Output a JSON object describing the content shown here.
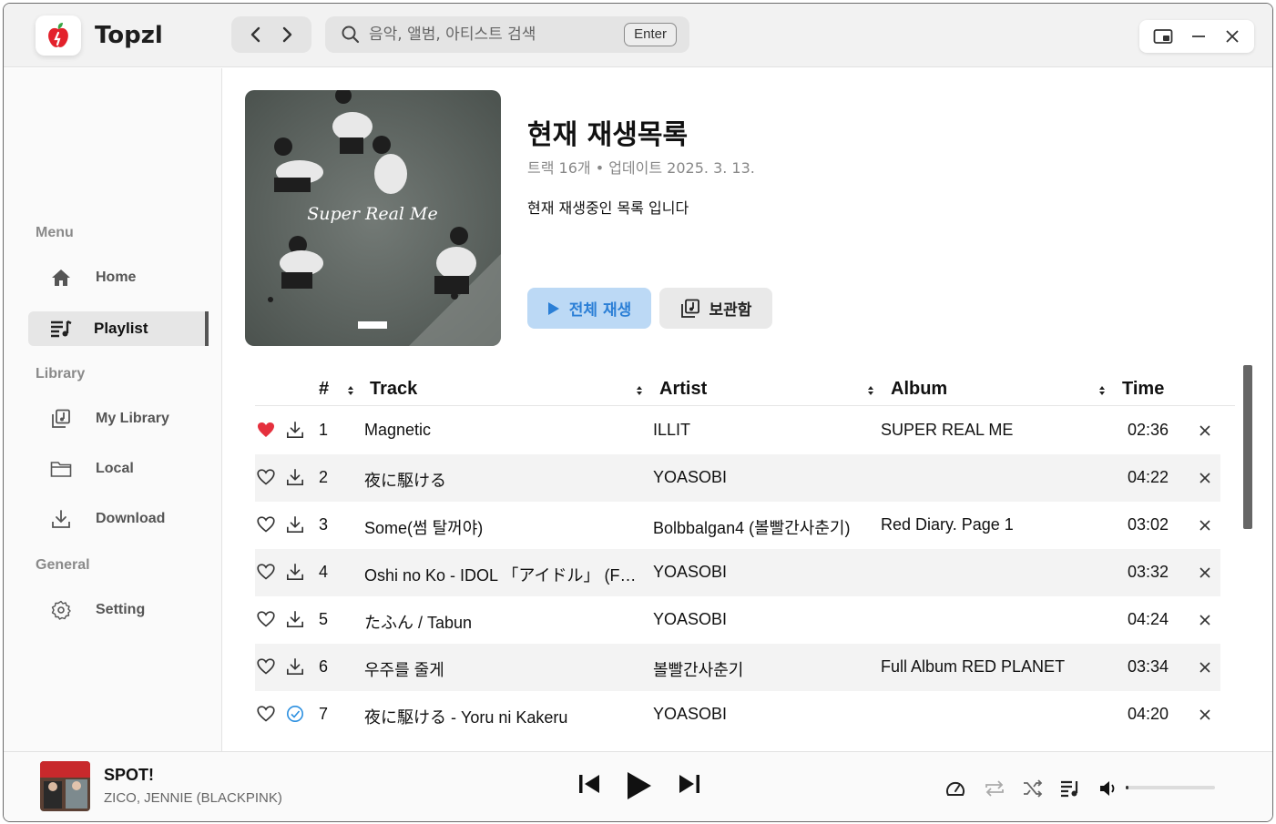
{
  "app": {
    "title": "Topzl",
    "accent": "#2b7fd6"
  },
  "search": {
    "placeholder": "음악, 앨범, 아티스트 검색",
    "enter_label": "Enter"
  },
  "sidebar": {
    "sections": {
      "menu": "Menu",
      "library": "Library",
      "general": "General"
    },
    "items": [
      {
        "label": "Home",
        "icon": "home-icon"
      },
      {
        "label": "Playlist",
        "icon": "playlist-icon",
        "active": true
      },
      {
        "label": "My Library",
        "icon": "library-icon"
      },
      {
        "label": "Local",
        "icon": "folder-icon"
      },
      {
        "label": "Download",
        "icon": "download-icon"
      },
      {
        "label": "Setting",
        "icon": "gear-icon"
      }
    ]
  },
  "playlist": {
    "title": "현재 재생목록",
    "meta": "트랙 16개 • 업데이트 2025. 3. 13.",
    "description": "현재 재생중인 목록 입니다",
    "play_all_label": "전체 재생",
    "save_label": "보관함",
    "cover_text": "Super Real Me"
  },
  "table": {
    "headers": {
      "num": "#",
      "track": "Track",
      "artist": "Artist",
      "album": "Album",
      "time": "Time"
    },
    "rows": [
      {
        "num": "1",
        "track": "Magnetic",
        "artist": "ILLIT",
        "album": "SUPER REAL ME",
        "time": "02:36",
        "liked": true,
        "downloaded": false
      },
      {
        "num": "2",
        "track": "夜に駆ける",
        "artist": "YOASOBI",
        "album": "",
        "time": "04:22",
        "liked": false,
        "downloaded": false
      },
      {
        "num": "3",
        "track": "Some(썸 탈꺼야)",
        "artist": "Bolbbalgan4 (볼빨간사춘기)",
        "album": "Red Diary. Page 1",
        "time": "03:02",
        "liked": false,
        "downloaded": false
      },
      {
        "num": "4",
        "track": "Oshi no Ko - IDOL 「アイドル」 (Full Ver.)",
        "artist": "YOASOBI",
        "album": "",
        "time": "03:32",
        "liked": false,
        "downloaded": false
      },
      {
        "num": "5",
        "track": "たふん / Tabun",
        "artist": "YOASOBI",
        "album": "",
        "time": "04:24",
        "liked": false,
        "downloaded": false
      },
      {
        "num": "6",
        "track": "우주를 줄게",
        "artist": "볼빨간사춘기",
        "album": "Full Album RED PLANET",
        "time": "03:34",
        "liked": false,
        "downloaded": false
      },
      {
        "num": "7",
        "track": "夜に駆ける - Yoru ni Kakeru",
        "artist": "YOASOBI",
        "album": "",
        "time": "04:20",
        "liked": false,
        "downloaded": true
      }
    ]
  },
  "player": {
    "title": "SPOT!",
    "artist": "ZICO, JENNIE (BLACKPINK)",
    "volume": 0.03
  }
}
